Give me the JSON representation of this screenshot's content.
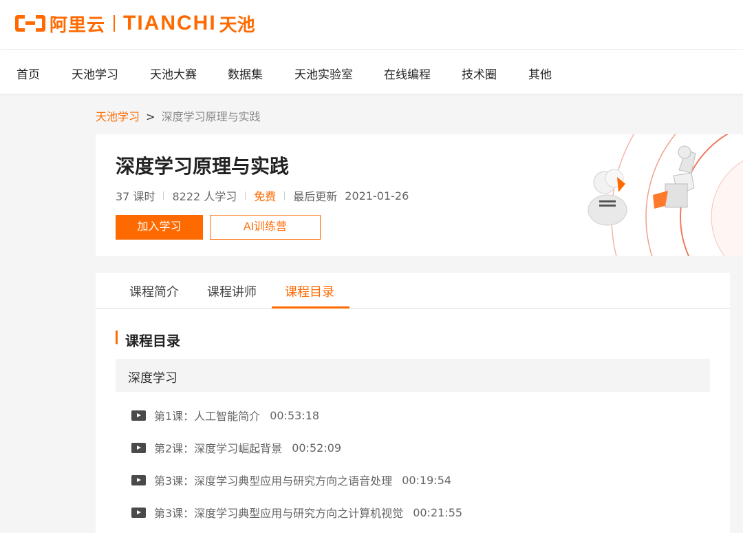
{
  "header": {
    "brand": "阿里云",
    "product": "TIANCHI",
    "product_cn": "天池"
  },
  "nav": {
    "items": [
      {
        "label": "首页"
      },
      {
        "label": "天池学习"
      },
      {
        "label": "天池大赛"
      },
      {
        "label": "数据集"
      },
      {
        "label": "天池实验室"
      },
      {
        "label": "在线编程"
      },
      {
        "label": "技术圈"
      },
      {
        "label": "其他"
      }
    ]
  },
  "breadcrumb": {
    "parent": "天池学习",
    "separator": ">",
    "current": "深度学习原理与实践"
  },
  "course": {
    "title": "深度学习原理与实践",
    "lessons_count": "37 课时",
    "learners": "8222 人学习",
    "price": "免费",
    "updated_label": "最后更新",
    "updated_date": "2021-01-26",
    "join_label": "加入学习",
    "camp_label": "AI训练营"
  },
  "tabs": {
    "items": [
      {
        "label": "课程简介"
      },
      {
        "label": "课程讲师"
      },
      {
        "label": "课程目录"
      }
    ],
    "active_index": 2
  },
  "catalog": {
    "heading": "课程目录",
    "chapter": "深度学习",
    "lessons": [
      {
        "title": "第1课：人工智能简介",
        "duration": "00:53:18"
      },
      {
        "title": "第2课：深度学习崛起背景",
        "duration": "00:52:09"
      },
      {
        "title": "第3课：深度学习典型应用与研究方向之语音处理",
        "duration": "00:19:54"
      },
      {
        "title": "第3课：深度学习典型应用与研究方向之计算机视觉",
        "duration": "00:21:55"
      }
    ]
  },
  "colors": {
    "accent": "#ff6a00",
    "background": "#f5f5f5"
  }
}
